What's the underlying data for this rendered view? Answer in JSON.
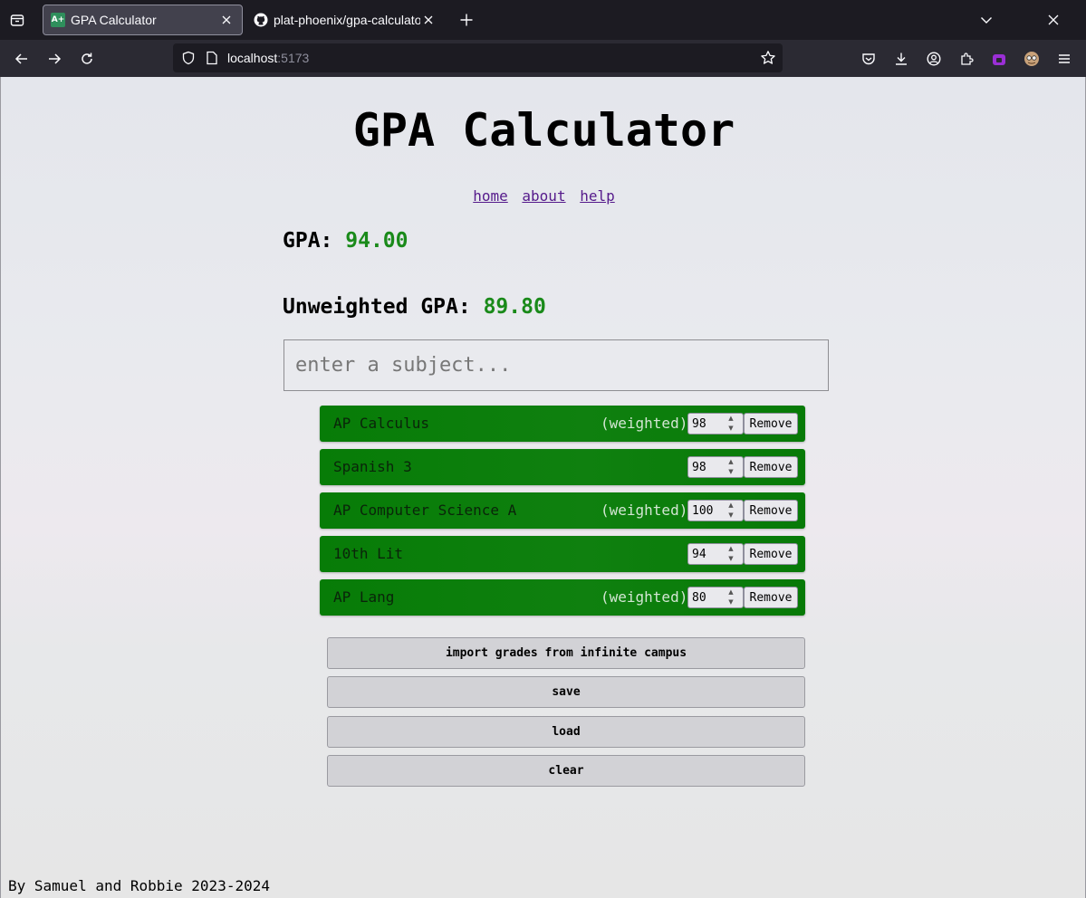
{
  "browser": {
    "tabs": [
      {
        "title": "GPA Calculator",
        "favicon_text": "A+",
        "active": true
      },
      {
        "title": "plat-phoenix/gpa-calculator",
        "active": false
      }
    ],
    "url_host": "localhost",
    "url_port": ":5173",
    "extension_badge": "0",
    "colors": {
      "tabbar": "#1c1b22",
      "navbar": "#2b2a33"
    }
  },
  "app": {
    "title": "GPA Calculator",
    "nav": [
      "home",
      "about",
      "help"
    ],
    "gpa_label": "GPA: ",
    "gpa_value": "94.00",
    "unweighted_label": "Unweighted GPA: ",
    "unweighted_value": "89.80",
    "subject_placeholder": "enter a subject...",
    "weighted_text": "(weighted)",
    "remove_label": "Remove",
    "classes": [
      {
        "name": "AP Calculus",
        "weighted": true,
        "grade": "98"
      },
      {
        "name": "Spanish 3",
        "weighted": false,
        "grade": "98"
      },
      {
        "name": "AP Computer Science A",
        "weighted": true,
        "grade": "100"
      },
      {
        "name": "10th Lit",
        "weighted": false,
        "grade": "94"
      },
      {
        "name": "AP Lang",
        "weighted": true,
        "grade": "80"
      }
    ],
    "actions": {
      "import": "import grades from infinite campus",
      "save": "save",
      "load": "load",
      "clear": "clear"
    },
    "footer": "By Samuel and Robbie 2023-2024",
    "colors": {
      "row_green": "#0a7d0a",
      "gpa_value": "#1a8a1a",
      "link": "#551a8b"
    }
  }
}
